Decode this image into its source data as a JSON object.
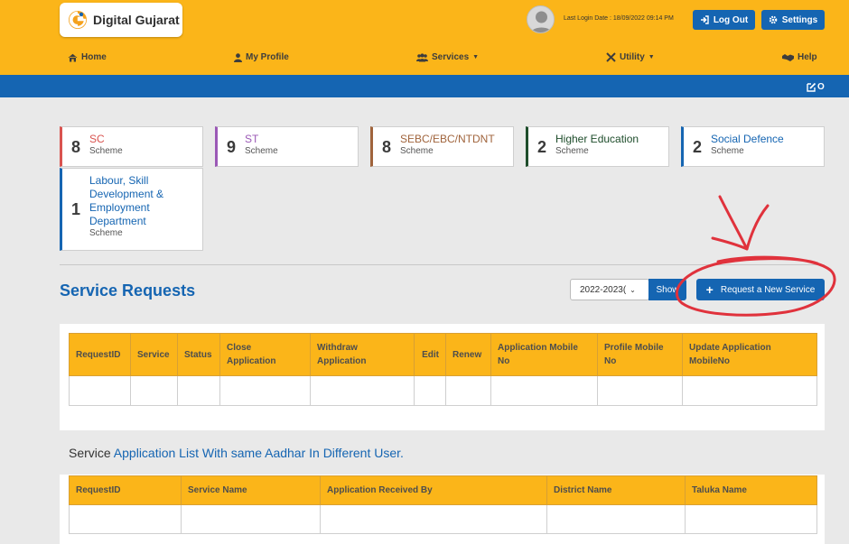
{
  "header": {
    "logo_text": "Digital Gujarat",
    "last_login": "Last Login Date : 18/09/2022 09:14 PM",
    "logout_label": "Log Out",
    "settings_label": "Settings"
  },
  "nav": {
    "home": "Home",
    "profile": "My Profile",
    "services": "Services",
    "utility": "Utility",
    "help": "Help"
  },
  "bluebar": {
    "edit_letter": "O"
  },
  "scheme_cards": [
    {
      "count": "8",
      "title": "SC",
      "subtitle": "Scheme",
      "color": "#d9534f"
    },
    {
      "count": "9",
      "title": "ST",
      "subtitle": "Scheme",
      "color": "#9b59b6"
    },
    {
      "count": "8",
      "title": "SEBC/EBC/NTDNT",
      "subtitle": "Scheme",
      "color": "#a0643c"
    },
    {
      "count": "2",
      "title": "Higher Education",
      "subtitle": "Scheme",
      "color": "#1e4d2b"
    },
    {
      "count": "2",
      "title": "Social Defence",
      "subtitle": "Scheme",
      "color": "#1565b2"
    },
    {
      "count": "1",
      "title_lines": [
        "Labour, Skill",
        "Development &",
        "Employment",
        "Department"
      ],
      "subtitle": "Scheme",
      "color": "#1565b2"
    }
  ],
  "service_requests": {
    "title": "Service Requests",
    "year_value": "2022-2023(",
    "show_label": "Show",
    "new_service_label": "Request a New Service",
    "columns": [
      [
        "RequestID"
      ],
      [
        "Service"
      ],
      [
        "Status"
      ],
      [
        "Close",
        "Application"
      ],
      [
        "Withdraw",
        "Application"
      ],
      [
        "Edit"
      ],
      [
        "Renew"
      ],
      [
        "Application Mobile",
        "No"
      ],
      [
        "Profile Mobile",
        "No"
      ],
      [
        "Update Application",
        "MobileNo"
      ]
    ]
  },
  "aadhar_section": {
    "title_first": "Service",
    "title_rest": " Application List With same Aadhar In Different User.",
    "columns": [
      "RequestID",
      "Service Name",
      "Application Received By",
      "District Name",
      "Taluka Name"
    ]
  },
  "colors": {
    "topbar": "#fbb519",
    "primary_blue": "#1565b2",
    "annotation_red": "#e0323c"
  }
}
